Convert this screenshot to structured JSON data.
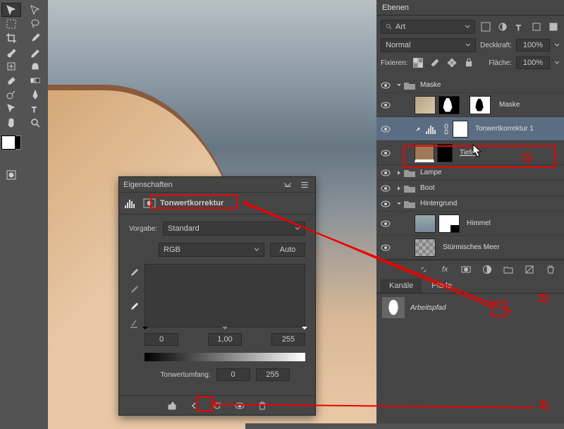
{
  "panels": {
    "layers_title": "Ebenen",
    "properties_title": "Eigenschaften",
    "channels_tab": "Kanäle",
    "paths_tab": "Pfade"
  },
  "layers": {
    "filter_label": "Art",
    "blend_mode": "Normal",
    "opacity_label": "Deckkraft:",
    "opacity_value": "100%",
    "lock_label": "Fixieren:",
    "fill_label": "Fläche:",
    "fill_value": "100%",
    "items": [
      {
        "name": "Maske",
        "type": "group",
        "open": true
      },
      {
        "name": "Maske",
        "type": "layer"
      },
      {
        "name": "Tonwertkorrektur 1",
        "type": "adjustment",
        "selected": true
      },
      {
        "name": "Tiefe",
        "type": "layer"
      },
      {
        "name": "Lampe",
        "type": "group",
        "open": false
      },
      {
        "name": "Boot",
        "type": "group",
        "open": false
      },
      {
        "name": "Hintergrund",
        "type": "group",
        "open": true
      },
      {
        "name": "Himmel",
        "type": "layer"
      },
      {
        "name": "Stürmisches Meer",
        "type": "layer"
      }
    ]
  },
  "paths": {
    "item_name": "Arbeitspfad"
  },
  "properties": {
    "adjustment_name": "Tonwertkorrektur",
    "preset_label": "Vorgabe:",
    "preset_value": "Standard",
    "channel": "RGB",
    "auto_button": "Auto",
    "shadow": "0",
    "mid": "1,00",
    "highlight": "255",
    "range_label": "Tonwertumfang:",
    "range_lo": "0",
    "range_hi": "255"
  },
  "annotations": {
    "a1": "1)",
    "a2": "2)",
    "a3": "3)"
  }
}
